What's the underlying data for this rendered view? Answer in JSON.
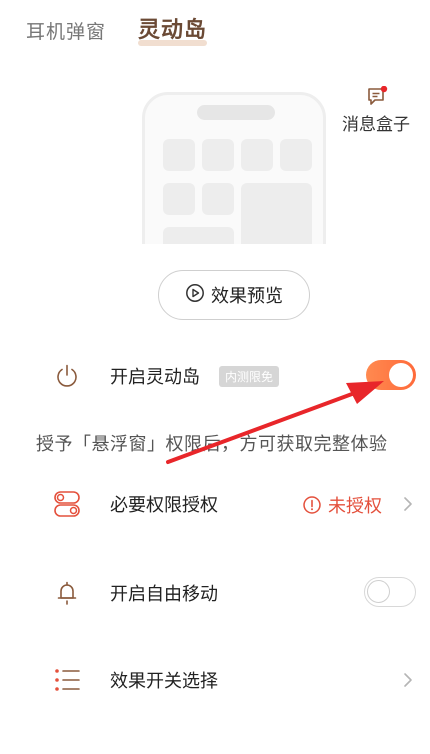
{
  "tabs": [
    {
      "label": "耳机弹窗",
      "active": false
    },
    {
      "label": "灵动岛",
      "active": true
    }
  ],
  "message_box": {
    "label": "消息盒子",
    "icon": "chat-bubble-icon",
    "has_notification_dot": true
  },
  "preview_button": {
    "label": "效果预览",
    "icon": "play-circle-icon"
  },
  "settings": {
    "enable_island": {
      "label": "开启灵动岛",
      "badge": "内测限免",
      "toggle_on": true,
      "icon": "power-icon"
    },
    "hint": "授予「悬浮窗」权限后，方可获取完整体验",
    "permission": {
      "label": "必要权限授权",
      "status": "未授权",
      "icon": "toggles-icon"
    },
    "free_move": {
      "label": "开启自由移动",
      "toggle_on": false,
      "icon": "bell-icon"
    },
    "effect_select": {
      "label": "效果开关选择",
      "icon": "list-icon"
    }
  },
  "colors": {
    "accent": "#ff6a3a",
    "warning": "#e4503c",
    "tab_active": "#6b4a35",
    "annotation_arrow": "#e8262a"
  }
}
